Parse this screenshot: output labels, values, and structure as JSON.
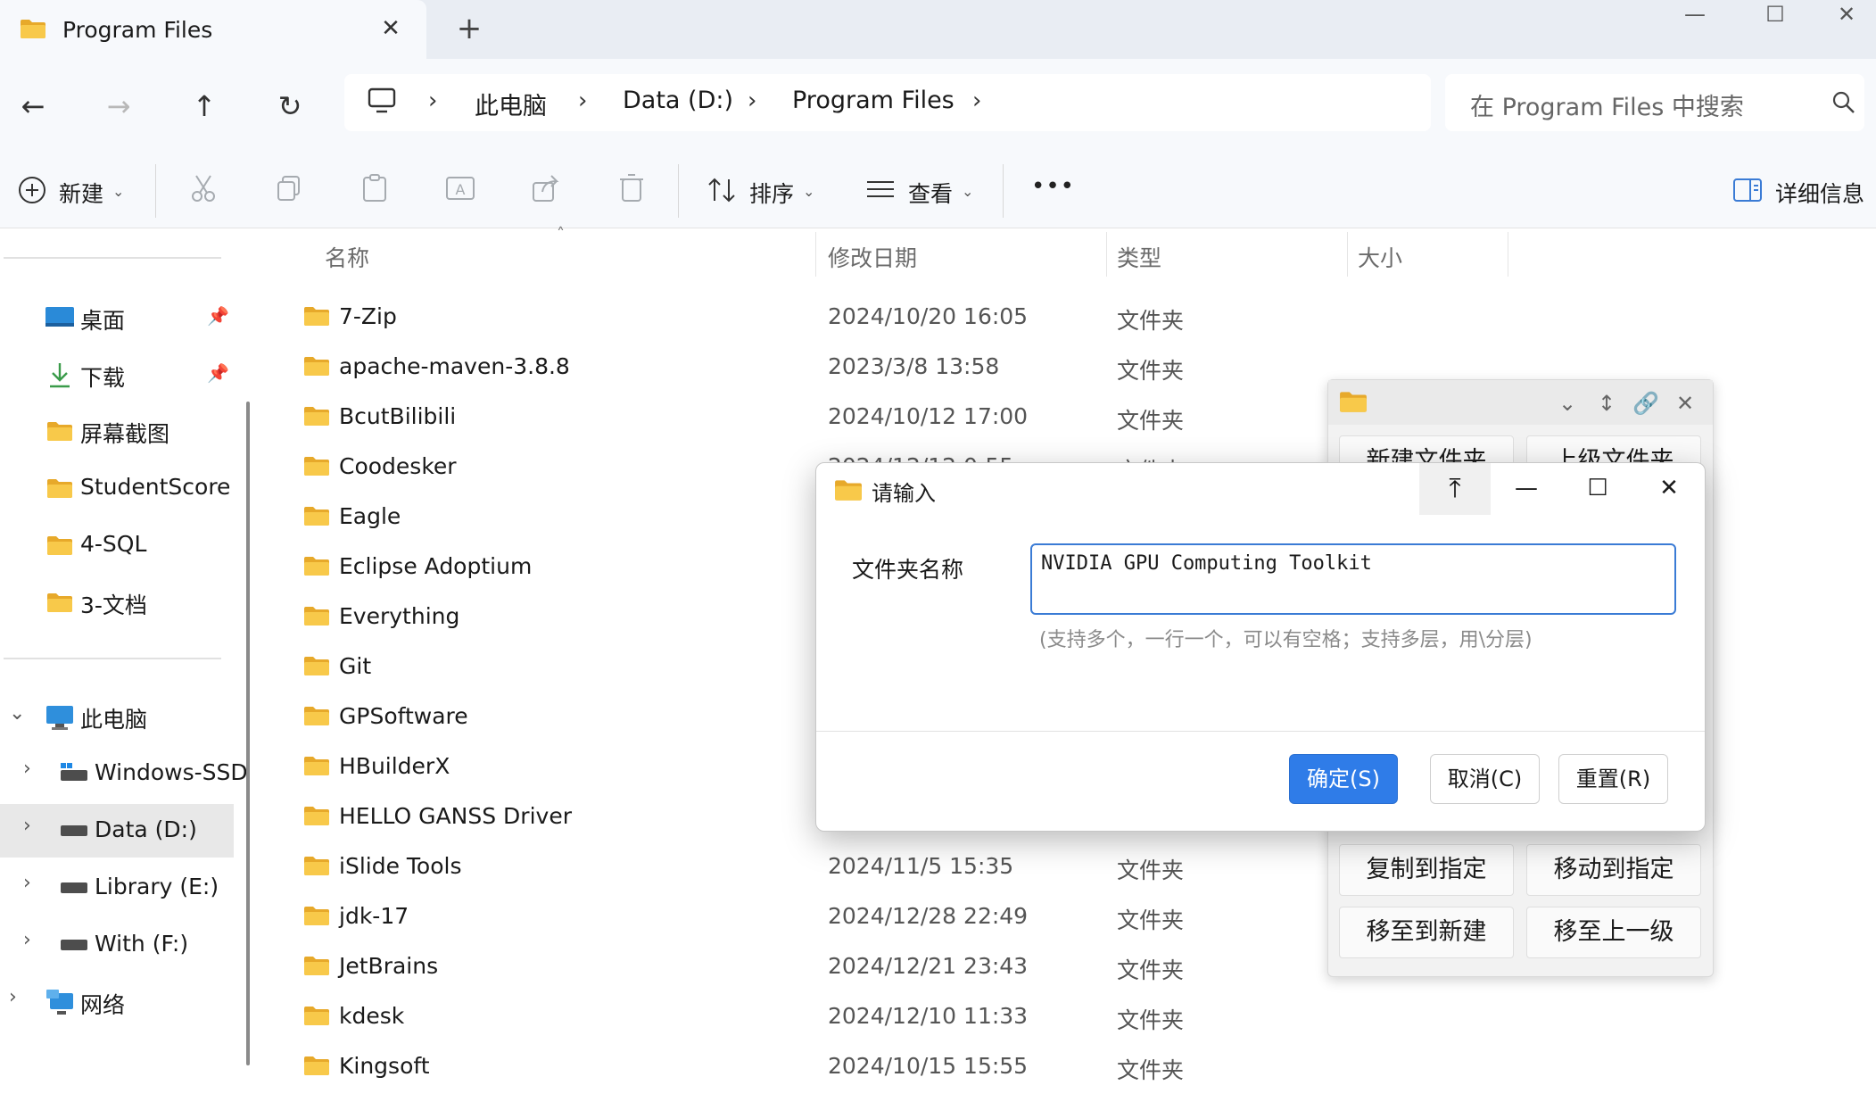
{
  "window": {
    "tab_title": "Program Files",
    "tab_close": "✕",
    "new_tab": "+",
    "minimize": "—",
    "maximize": "☐",
    "close": "✕"
  },
  "nav": {
    "back": "←",
    "forward": "→",
    "up": "↑",
    "refresh": "↻",
    "breadcrumb": [
      "此电脑",
      "Data (D:)",
      "Program Files"
    ],
    "search_placeholder": "在 Program Files 中搜索"
  },
  "toolbar": {
    "new_label": "新建",
    "sort_label": "排序",
    "view_label": "查看",
    "more": "•••",
    "details_label": "详细信息"
  },
  "sidebar": {
    "quick": [
      {
        "label": "桌面",
        "icon": "desktop-icon",
        "pinned": true
      },
      {
        "label": "下载",
        "icon": "download-icon",
        "pinned": true
      },
      {
        "label": "屏幕截图",
        "icon": "folder-icon",
        "pinned": false
      },
      {
        "label": "StudentScore",
        "icon": "folder-icon",
        "pinned": false
      },
      {
        "label": "4-SQL",
        "icon": "folder-icon",
        "pinned": false
      },
      {
        "label": "3-文档",
        "icon": "folder-icon",
        "pinned": false
      }
    ],
    "this_pc": "此电脑",
    "drives": [
      {
        "label": "Windows-SSD",
        "selected": false
      },
      {
        "label": "Data (D:)",
        "selected": true
      },
      {
        "label": "Library (E:)",
        "selected": false
      },
      {
        "label": "With (F:)",
        "selected": false
      }
    ],
    "network": "网络"
  },
  "columns": {
    "name": "名称",
    "modified": "修改日期",
    "type": "类型",
    "size": "大小"
  },
  "files": [
    {
      "name": "7-Zip",
      "date": "2024/10/20 16:05",
      "type": "文件夹"
    },
    {
      "name": "apache-maven-3.8.8",
      "date": "2023/3/8 13:58",
      "type": "文件夹"
    },
    {
      "name": "BcutBilibili",
      "date": "2024/10/12 17:00",
      "type": "文件夹"
    },
    {
      "name": "Coodesker",
      "date": "2024/12/12 0:55",
      "type": "文件夹"
    },
    {
      "name": "Eagle",
      "date": "",
      "type": ""
    },
    {
      "name": "Eclipse Adoptium",
      "date": "",
      "type": ""
    },
    {
      "name": "Everything",
      "date": "",
      "type": ""
    },
    {
      "name": "Git",
      "date": "",
      "type": ""
    },
    {
      "name": "GPSoftware",
      "date": "",
      "type": ""
    },
    {
      "name": "HBuilderX",
      "date": "",
      "type": ""
    },
    {
      "name": "HELLO GANSS  Driver",
      "date": "",
      "type": ""
    },
    {
      "name": "iSlide Tools",
      "date": "2024/11/5 15:35",
      "type": "文件夹"
    },
    {
      "name": "jdk-17",
      "date": "2024/12/28 22:49",
      "type": "文件夹"
    },
    {
      "name": "JetBrains",
      "date": "2024/12/21 23:43",
      "type": "文件夹"
    },
    {
      "name": "kdesk",
      "date": "2024/12/10 11:33",
      "type": "文件夹"
    },
    {
      "name": "Kingsoft",
      "date": "2024/10/15 15:55",
      "type": "文件夹"
    }
  ],
  "tool_panel": {
    "buttons_top": [
      "新建文件夹",
      "上级文件夹"
    ],
    "buttons_bottom": [
      "复制到指定",
      "移动到指定",
      "移至到新建",
      "移至上一级"
    ]
  },
  "dialog": {
    "title": "请输入",
    "pin": "⤒",
    "minimize": "—",
    "maximize": "☐",
    "close": "✕",
    "field_label": "文件夹名称",
    "field_value": "NVIDIA GPU Computing Toolkit",
    "hint": "(支持多个，一行一个，可以有空格；支持多层，用\\分层)",
    "ok": "确定(S)",
    "cancel": "取消(C)",
    "reset": "重置(R)"
  },
  "colors": {
    "accent": "#2f7ce8",
    "folder_yellow": "#f8c94a",
    "folder_yellow_dark": "#e7a92a"
  }
}
